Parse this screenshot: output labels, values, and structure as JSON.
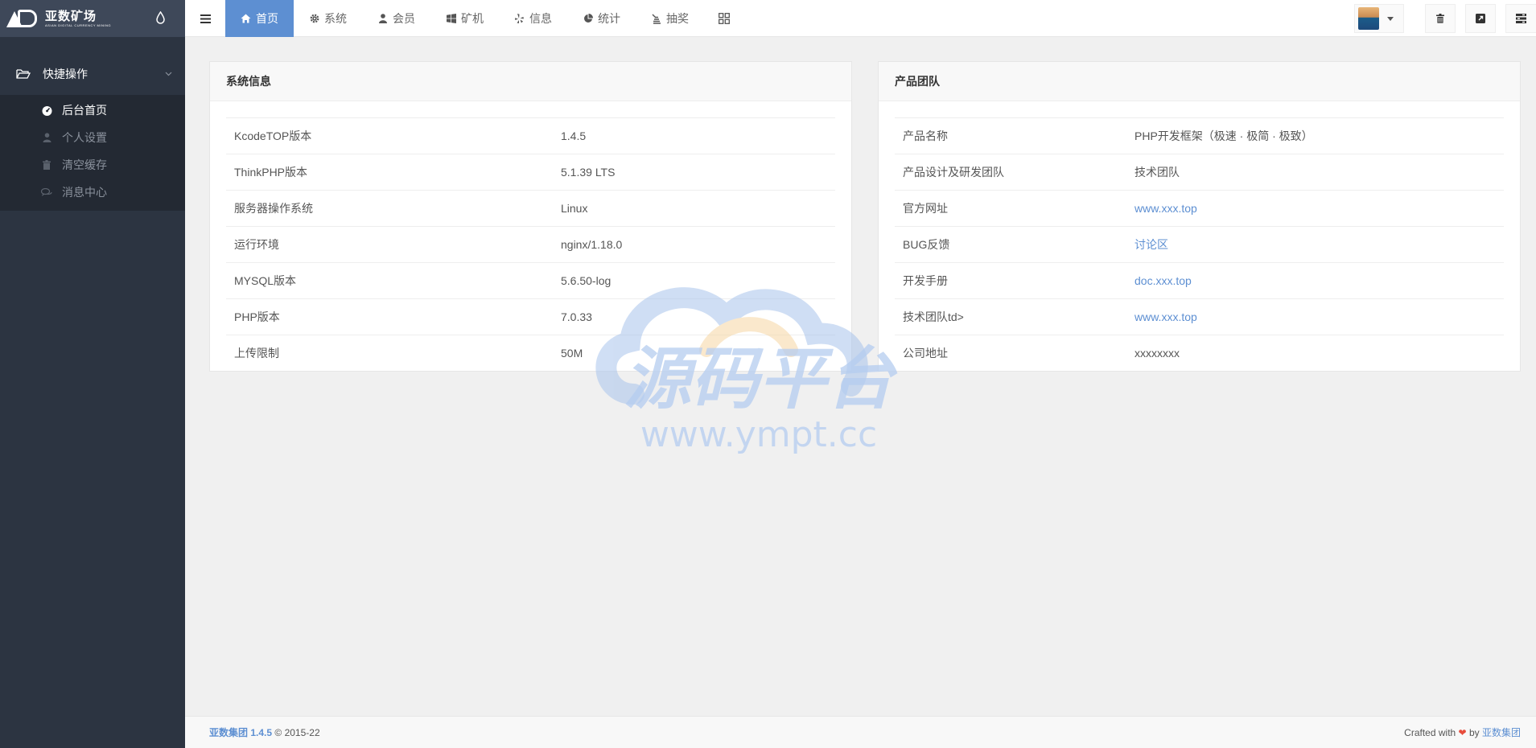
{
  "brand": {
    "name": "亚数矿场",
    "tagline": "ASIAN DIGITAL CURRENCY MINING",
    "theme_icon": "droplet-icon"
  },
  "sidebar": {
    "group_label": "快捷操作",
    "items": [
      {
        "label": "后台首页",
        "icon": "dashboard-icon",
        "active": true
      },
      {
        "label": "个人设置",
        "icon": "user-icon",
        "active": false
      },
      {
        "label": "清空缓存",
        "icon": "trash-icon",
        "active": false
      },
      {
        "label": "消息中心",
        "icon": "comments-icon",
        "active": false
      }
    ]
  },
  "topnav": {
    "items": [
      {
        "label": "首页",
        "icon": "home-icon",
        "active": true
      },
      {
        "label": "系统",
        "icon": "gear-icon"
      },
      {
        "label": "会员",
        "icon": "user-icon"
      },
      {
        "label": "矿机",
        "icon": "windows-icon"
      },
      {
        "label": "信息",
        "icon": "yelp-icon"
      },
      {
        "label": "统计",
        "icon": "pie-chart-icon"
      },
      {
        "label": "抽奖",
        "icon": "coins-icon"
      }
    ]
  },
  "system_panel": {
    "title": "系统信息",
    "rows": [
      {
        "key": "KcodeTOP版本",
        "value": "1.4.5"
      },
      {
        "key": "ThinkPHP版本",
        "value": "5.1.39 LTS"
      },
      {
        "key": "服务器操作系统",
        "value": "Linux"
      },
      {
        "key": "运行环境",
        "value": "nginx/1.18.0"
      },
      {
        "key": "MYSQL版本",
        "value": "5.6.50-log"
      },
      {
        "key": "PHP版本",
        "value": "7.0.33"
      },
      {
        "key": "上传限制",
        "value": "50M"
      }
    ]
  },
  "team_panel": {
    "title": "产品团队",
    "rows": [
      {
        "key": "产品名称",
        "value": "PHP开发框架（极速 · 极简 · 极致）",
        "link": false
      },
      {
        "key": "产品设计及研发团队",
        "value": "技术团队",
        "link": false
      },
      {
        "key": "官方网址",
        "value": "www.xxx.top",
        "link": true
      },
      {
        "key": "BUG反馈",
        "value": "讨论区",
        "link": true
      },
      {
        "key": "开发手册",
        "value": "doc.xxx.top",
        "link": true
      },
      {
        "key": "技术团队td>",
        "value": "www.xxx.top",
        "link": true
      },
      {
        "key": "公司地址",
        "value": "xxxxxxxx",
        "link": false
      }
    ]
  },
  "watermark": {
    "title": "源码平台",
    "url": "www.ympt.cc"
  },
  "footer": {
    "company": "亚数集团",
    "version": "1.4.5",
    "copyright": "© 2015-22",
    "crafted_with": "Crafted with",
    "by": "by",
    "author": "亚数集团"
  },
  "colors": {
    "accent": "#5d8fd2",
    "sidebar_bg": "#2c3441",
    "brand_bg": "#3e4859",
    "heart": "#e74c3c"
  }
}
